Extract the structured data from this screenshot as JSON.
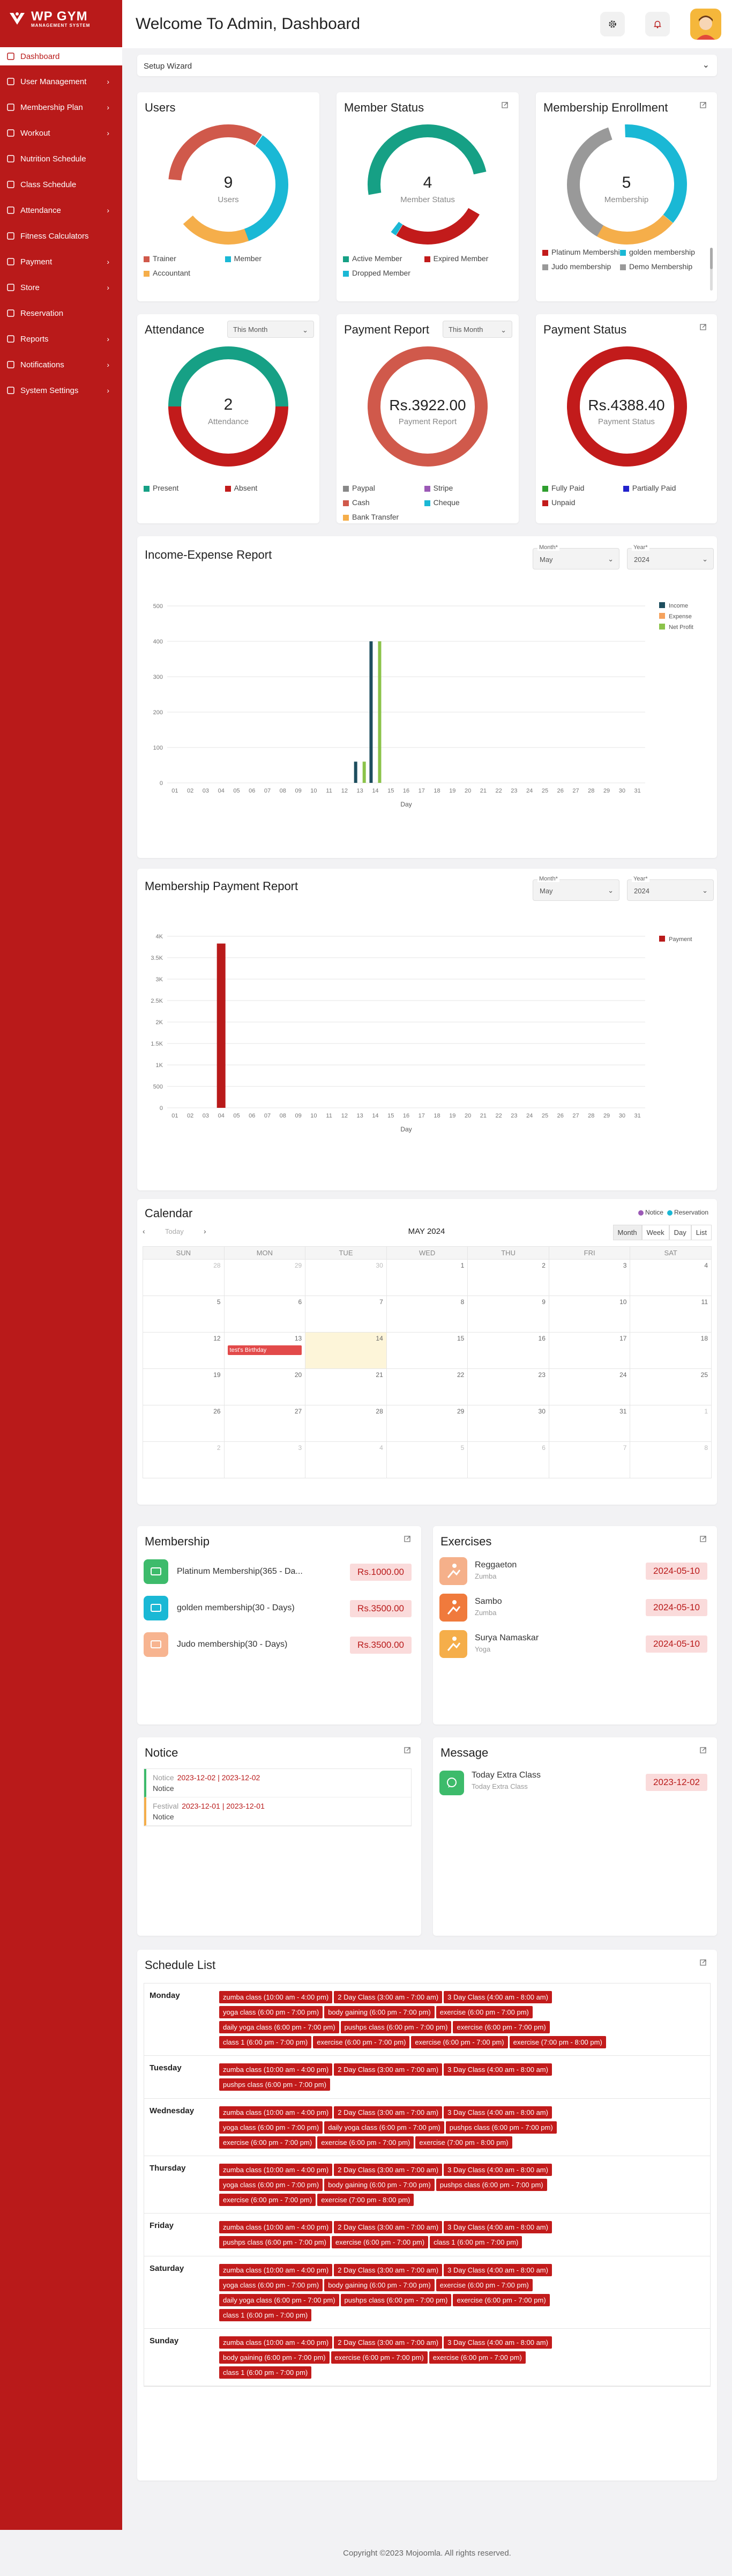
{
  "app": {
    "name": "WP GYM",
    "sub": "MANAGEMENT SYSTEM"
  },
  "sidebar": {
    "items": [
      {
        "label": "Dashboard",
        "icon": "grid-icon",
        "chev": false
      },
      {
        "label": "User Management",
        "icon": "user-icon",
        "chev": true
      },
      {
        "label": "Membership Plan",
        "icon": "card-icon",
        "chev": true
      },
      {
        "label": "Workout",
        "icon": "dumbbell-icon",
        "chev": true
      },
      {
        "label": "Nutrition Schedule",
        "icon": "nutrition-icon",
        "chev": false
      },
      {
        "label": "Class Schedule",
        "icon": "calendar-icon",
        "chev": false
      },
      {
        "label": "Attendance",
        "icon": "attendance-icon",
        "chev": true
      },
      {
        "label": "Fitness Calculators",
        "icon": "calculator-icon",
        "chev": false
      },
      {
        "label": "Payment",
        "icon": "payment-icon",
        "chev": true
      },
      {
        "label": "Store",
        "icon": "store-icon",
        "chev": true
      },
      {
        "label": "Reservation",
        "icon": "reservation-icon",
        "chev": false
      },
      {
        "label": "Reports",
        "icon": "reports-icon",
        "chev": true
      },
      {
        "label": "Notifications",
        "icon": "bell-icon",
        "chev": true
      },
      {
        "label": "System Settings",
        "icon": "settings-icon",
        "chev": true
      }
    ]
  },
  "header": {
    "title": "Welcome To Admin, Dashboard"
  },
  "setup": {
    "label": "Setup Wizard"
  },
  "users": {
    "title": "Users",
    "value": "9",
    "label": "Users",
    "legend": [
      {
        "name": "Trainer",
        "color": "#d0594b"
      },
      {
        "name": "Member",
        "color": "#1ab8d5"
      },
      {
        "name": "Accountant",
        "color": "#f5ae4a"
      }
    ]
  },
  "member_status": {
    "title": "Member Status",
    "value": "4",
    "label": "Member Status",
    "legend": [
      {
        "name": "Active Member",
        "color": "#16a085"
      },
      {
        "name": "Expired Member",
        "color": "#c21b1b"
      },
      {
        "name": "Dropped Member",
        "color": "#1ab8d5"
      }
    ]
  },
  "membership_enroll": {
    "title": "Membership Enrollment",
    "value": "5",
    "label": "Membership",
    "legend": [
      {
        "name": "Platinum Membership",
        "color": "#c21b1b"
      },
      {
        "name": "golden membership",
        "color": "#1ab8d5"
      },
      {
        "name": "Judo membership",
        "color": "#999999"
      },
      {
        "name": "Demo Membership",
        "color": "#999999"
      }
    ]
  },
  "attendance": {
    "title": "Attendance",
    "filter": "This Month",
    "value": "2",
    "label": "Attendance",
    "legend": [
      {
        "name": "Present",
        "color": "#16a085"
      },
      {
        "name": "Absent",
        "color": "#c21b1b"
      }
    ]
  },
  "payment_report": {
    "title": "Payment Report",
    "filter": "This Month",
    "value": "Rs.3922.00",
    "label": "Payment Report",
    "legend": [
      {
        "name": "Paypal",
        "color": "#888888"
      },
      {
        "name": "Stripe",
        "color": "#9b59b6"
      },
      {
        "name": "Cash",
        "color": "#d0594b"
      },
      {
        "name": "Cheque",
        "color": "#1ab8d5"
      },
      {
        "name": "Bank Transfer",
        "color": "#f5ae4a"
      }
    ]
  },
  "payment_status": {
    "title": "Payment Status",
    "value": "Rs.4388.40",
    "label": "Payment Status",
    "legend": [
      {
        "name": "Fully Paid",
        "color": "#2e9e2e"
      },
      {
        "name": "Partially Paid",
        "color": "#2222cc"
      },
      {
        "name": "Unpaid",
        "color": "#c21b1b"
      }
    ]
  },
  "income": {
    "title": "Income-Expense Report",
    "month_label": "Month*",
    "month": "May",
    "year_label": "Year*",
    "year": "2024",
    "xlabel": "Day"
  },
  "membership_payment": {
    "title": "Membership Payment Report",
    "month_label": "Month*",
    "month": "May",
    "year_label": "Year*",
    "year": "2024",
    "xlabel": "Day"
  },
  "chart_data": [
    {
      "type": "bar",
      "title": "Income-Expense Report",
      "xlabel": "Day",
      "ylim": [
        0,
        500
      ],
      "yticks": [
        0,
        100,
        200,
        300,
        400,
        500
      ],
      "categories": [
        "01",
        "02",
        "03",
        "04",
        "05",
        "06",
        "07",
        "08",
        "09",
        "10",
        "11",
        "12",
        "13",
        "14",
        "15",
        "16",
        "17",
        "18",
        "19",
        "20",
        "21",
        "22",
        "23",
        "24",
        "25",
        "26",
        "27",
        "28",
        "29",
        "30",
        "31"
      ],
      "series": [
        {
          "name": "Income",
          "color": "#1d4e5e",
          "values": [
            0,
            0,
            0,
            0,
            0,
            0,
            0,
            0,
            0,
            0,
            0,
            0,
            60,
            400,
            0,
            0,
            0,
            0,
            0,
            0,
            0,
            0,
            0,
            0,
            0,
            0,
            0,
            0,
            0,
            0,
            0
          ]
        },
        {
          "name": "Expense",
          "color": "#f5a25d",
          "values": [
            0,
            0,
            0,
            0,
            0,
            0,
            0,
            0,
            0,
            0,
            0,
            0,
            0,
            0,
            0,
            0,
            0,
            0,
            0,
            0,
            0,
            0,
            0,
            0,
            0,
            0,
            0,
            0,
            0,
            0,
            0
          ]
        },
        {
          "name": "Net Profit",
          "color": "#8bc34a",
          "values": [
            0,
            0,
            0,
            0,
            0,
            0,
            0,
            0,
            0,
            0,
            0,
            0,
            60,
            400,
            0,
            0,
            0,
            0,
            0,
            0,
            0,
            0,
            0,
            0,
            0,
            0,
            0,
            0,
            0,
            0,
            0
          ]
        }
      ],
      "legend": "top-right"
    },
    {
      "type": "bar",
      "title": "Membership Payment Report",
      "xlabel": "Day",
      "ylim": [
        0,
        4000
      ],
      "yticks": [
        0,
        500,
        1000,
        1500,
        2000,
        2500,
        3000,
        3500,
        4000
      ],
      "ytick_labels": [
        "0",
        "500",
        "1K",
        "1.5K",
        "2K",
        "2.5K",
        "3K",
        "3.5K",
        "4K"
      ],
      "categories": [
        "01",
        "02",
        "03",
        "04",
        "05",
        "06",
        "07",
        "08",
        "09",
        "10",
        "11",
        "12",
        "13",
        "14",
        "15",
        "16",
        "17",
        "18",
        "19",
        "20",
        "21",
        "22",
        "23",
        "24",
        "25",
        "26",
        "27",
        "28",
        "29",
        "30",
        "31"
      ],
      "series": [
        {
          "name": "Payment",
          "color": "#b91a1a",
          "values": [
            0,
            0,
            0,
            3830,
            0,
            0,
            0,
            0,
            0,
            0,
            0,
            0,
            0,
            0,
            0,
            0,
            0,
            0,
            0,
            0,
            0,
            0,
            0,
            0,
            0,
            0,
            0,
            0,
            0,
            0,
            0
          ]
        }
      ],
      "legend": "top-right"
    }
  ],
  "calendar": {
    "title": "Calendar",
    "notice": "Notice",
    "reservation": "Reservation",
    "today": "Today",
    "month": "MAY 2024",
    "views": [
      "Month",
      "Week",
      "Day",
      "List"
    ],
    "days": [
      "SUN",
      "MON",
      "TUE",
      "WED",
      "THU",
      "FRI",
      "SAT"
    ],
    "weeks": [
      [
        "28",
        "29",
        "30",
        "1",
        "2",
        "3",
        "4"
      ],
      [
        "5",
        "6",
        "7",
        "8",
        "9",
        "10",
        "11"
      ],
      [
        "12",
        "13",
        "14",
        "15",
        "16",
        "17",
        "18"
      ],
      [
        "19",
        "20",
        "21",
        "22",
        "23",
        "24",
        "25"
      ],
      [
        "26",
        "27",
        "28",
        "29",
        "30",
        "31",
        "1"
      ],
      [
        "2",
        "3",
        "4",
        "5",
        "6",
        "7",
        "8"
      ]
    ],
    "event": "test's Birthday"
  },
  "membership": {
    "title": "Membership",
    "items": [
      {
        "name": "Platinum Membership(365 - Da...",
        "price": "Rs.1000.00",
        "color": "#3dbb6b"
      },
      {
        "name": "golden membership(30 - Days)",
        "price": "Rs.3500.00",
        "color": "#1ab8d5"
      },
      {
        "name": "Judo membership(30 - Days)",
        "price": "Rs.3500.00",
        "color": "#f7b490"
      }
    ]
  },
  "exercises": {
    "title": "Exercises",
    "items": [
      {
        "name": "Reggaeton",
        "sub": "Zumba",
        "date": "2024-05-10",
        "color": "#f5b08a"
      },
      {
        "name": "Sambo",
        "sub": "Zumba",
        "date": "2024-05-10",
        "color": "#f07a3c"
      },
      {
        "name": "Surya Namaskar",
        "sub": "Yoga",
        "date": "2024-05-10",
        "color": "#f5ae4a"
      }
    ]
  },
  "notice": {
    "title": "Notice",
    "items": [
      {
        "name": "Notice",
        "range": "2023-12-02 | 2023-12-02",
        "sub": "Notice",
        "color": "#3dbb6b"
      },
      {
        "name": "Festival",
        "range": "2023-12-01 | 2023-12-01",
        "sub": "Notice",
        "color": "#f5ae4a"
      }
    ]
  },
  "message": {
    "title": "Message",
    "name": "Today Extra Class",
    "sub": "Today Extra Class",
    "date": "2023-12-02"
  },
  "schedule": {
    "title": "Schedule List",
    "rows": [
      {
        "day": "Monday",
        "tags": [
          "zumba class (10:00 am - 4:00 pm)",
          "2 Day Class (3:00 am - 7:00 am)",
          "3 Day Class (4:00 am - 8:00 am)",
          "yoga class (6:00 pm - 7:00 pm)",
          "body gaining (6:00 pm - 7:00 pm)",
          "exercise (6:00 pm - 7:00 pm)",
          "daily yoga class (6:00 pm - 7:00 pm)",
          "pushps class (6:00 pm - 7:00 pm)",
          "exercise (6:00 pm - 7:00 pm)",
          "class 1 (6:00 pm - 7:00 pm)",
          "exercise (6:00 pm - 7:00 pm)",
          "exercise (6:00 pm - 7:00 pm)",
          "exercise (7:00 pm - 8:00 pm)"
        ]
      },
      {
        "day": "Tuesday",
        "tags": [
          "zumba class (10:00 am - 4:00 pm)",
          "2 Day Class (3:00 am - 7:00 am)",
          "3 Day Class (4:00 am - 8:00 am)",
          "pushps class (6:00 pm - 7:00 pm)"
        ]
      },
      {
        "day": "Wednesday",
        "tags": [
          "zumba class (10:00 am - 4:00 pm)",
          "2 Day Class (3:00 am - 7:00 am)",
          "3 Day Class (4:00 am - 8:00 am)",
          "yoga class (6:00 pm - 7:00 pm)",
          "daily yoga class (6:00 pm - 7:00 pm)",
          "pushps class (6:00 pm - 7:00 pm)",
          "exercise (6:00 pm - 7:00 pm)",
          "exercise (6:00 pm - 7:00 pm)",
          "exercise (7:00 pm - 8:00 pm)"
        ]
      },
      {
        "day": "Thursday",
        "tags": [
          "zumba class (10:00 am - 4:00 pm)",
          "2 Day Class (3:00 am - 7:00 am)",
          "3 Day Class (4:00 am - 8:00 am)",
          "yoga class (6:00 pm - 7:00 pm)",
          "body gaining (6:00 pm - 7:00 pm)",
          "pushps class (6:00 pm - 7:00 pm)",
          "exercise (6:00 pm - 7:00 pm)",
          "exercise (7:00 pm - 8:00 pm)"
        ]
      },
      {
        "day": "Friday",
        "tags": [
          "zumba class (10:00 am - 4:00 pm)",
          "2 Day Class (3:00 am - 7:00 am)",
          "3 Day Class (4:00 am - 8:00 am)",
          "pushps class (6:00 pm - 7:00 pm)",
          "exercise (6:00 pm - 7:00 pm)",
          "class 1 (6:00 pm - 7:00 pm)"
        ]
      },
      {
        "day": "Saturday",
        "tags": [
          "zumba class (10:00 am - 4:00 pm)",
          "2 Day Class (3:00 am - 7:00 am)",
          "3 Day Class (4:00 am - 8:00 am)",
          "yoga class (6:00 pm - 7:00 pm)",
          "body gaining (6:00 pm - 7:00 pm)",
          "exercise (6:00 pm - 7:00 pm)",
          "daily yoga class (6:00 pm - 7:00 pm)",
          "pushps class (6:00 pm - 7:00 pm)",
          "exercise (6:00 pm - 7:00 pm)",
          "class 1 (6:00 pm - 7:00 pm)"
        ]
      },
      {
        "day": "Sunday",
        "tags": [
          "zumba class (10:00 am - 4:00 pm)",
          "2 Day Class (3:00 am - 7:00 am)",
          "3 Day Class (4:00 am - 8:00 am)",
          "body gaining (6:00 pm - 7:00 pm)",
          "exercise (6:00 pm - 7:00 pm)",
          "exercise (6:00 pm - 7:00 pm)",
          "class 1 (6:00 pm - 7:00 pm)"
        ]
      }
    ]
  },
  "footer": {
    "text": "Copyright ©2023 Mojoomla. All rights reserved."
  }
}
